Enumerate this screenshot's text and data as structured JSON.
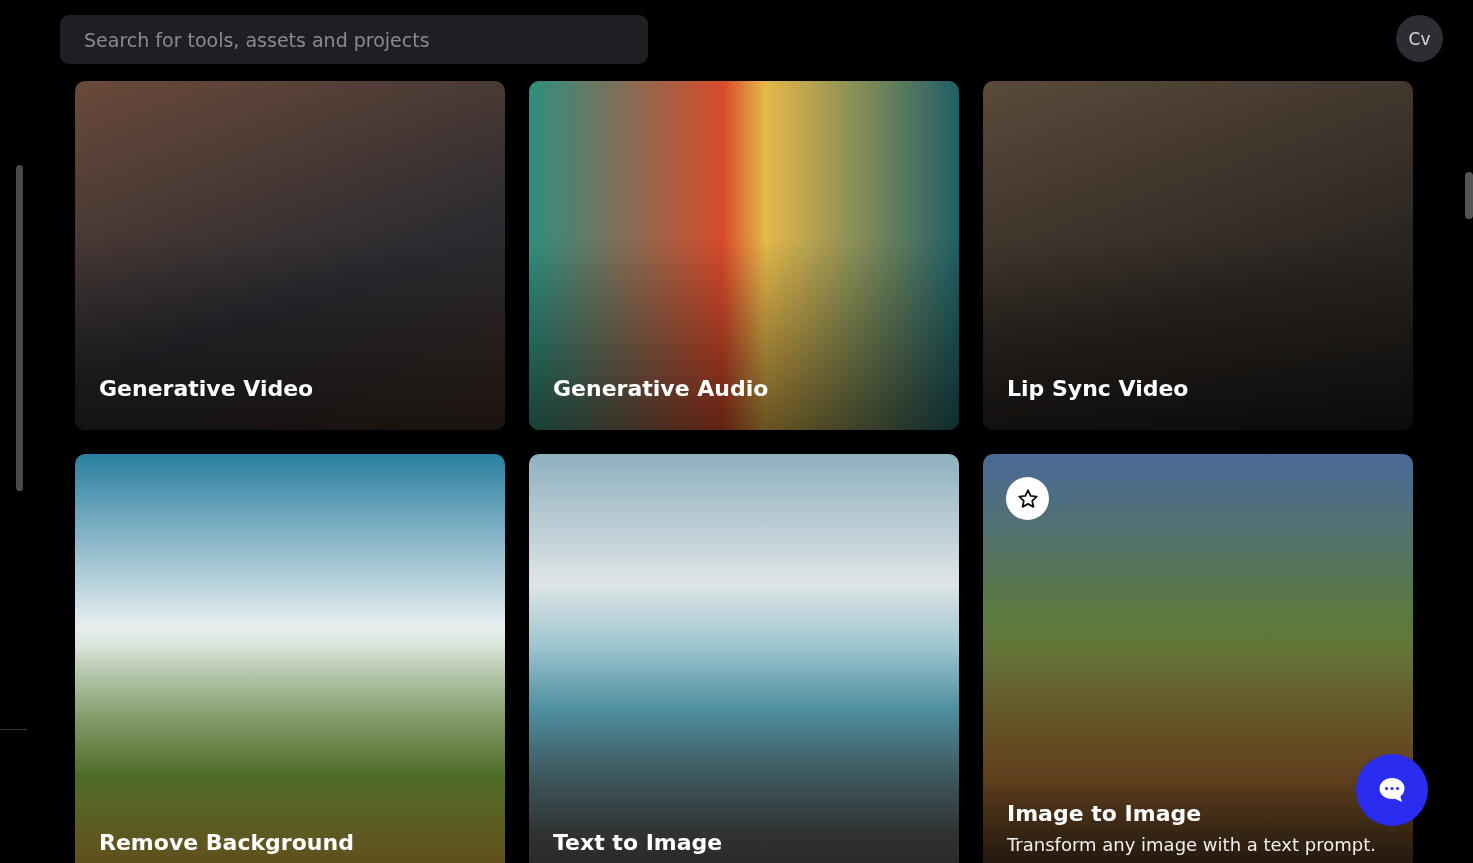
{
  "search": {
    "placeholder": "Search for tools, assets and projects"
  },
  "user": {
    "initials": "Cv"
  },
  "tools": [
    {
      "title": "Generative Video",
      "favorite_visible": false
    },
    {
      "title": "Generative Audio",
      "favorite_visible": false
    },
    {
      "title": "Lip Sync Video",
      "favorite_visible": false
    },
    {
      "title": "Remove Background",
      "favorite_visible": false
    },
    {
      "title": "Text to Image",
      "favorite_visible": false
    },
    {
      "title": "Image to Image",
      "description": "Transform any image with a text prompt.",
      "favorite_visible": true
    }
  ]
}
